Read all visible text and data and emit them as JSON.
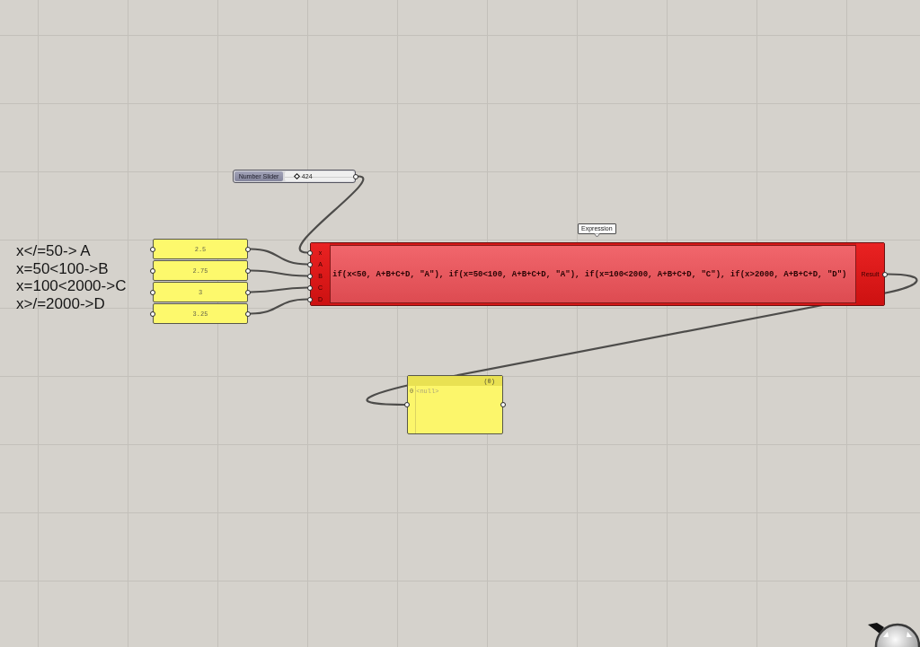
{
  "canvas": {
    "notes": [
      "x</=50-> A",
      "x=50<100->B",
      "x=100<2000->C",
      "x>/=2000->D"
    ],
    "number_slider": {
      "label": "Number Slider",
      "value": "424",
      "level": 0.18
    },
    "panels": [
      {
        "value": "2.5"
      },
      {
        "value": "2.75"
      },
      {
        "value": "3"
      },
      {
        "value": "3.25"
      }
    ],
    "expression": {
      "tooltip": "Expression",
      "inputs": [
        "x",
        "A",
        "B",
        "C",
        "D"
      ],
      "formula": "if(x<50, A+B+C+D, \"A\"), if(x=50<100, A+B+C+D, \"A\"), if(x=100<2000, A+B+C+D, \"C\"), if(x>2000, A+B+C+D, \"D\")",
      "output": "Result"
    },
    "output_panel": {
      "count": "(0)",
      "rows": [
        {
          "index": "0",
          "value": "<null>"
        }
      ]
    }
  }
}
